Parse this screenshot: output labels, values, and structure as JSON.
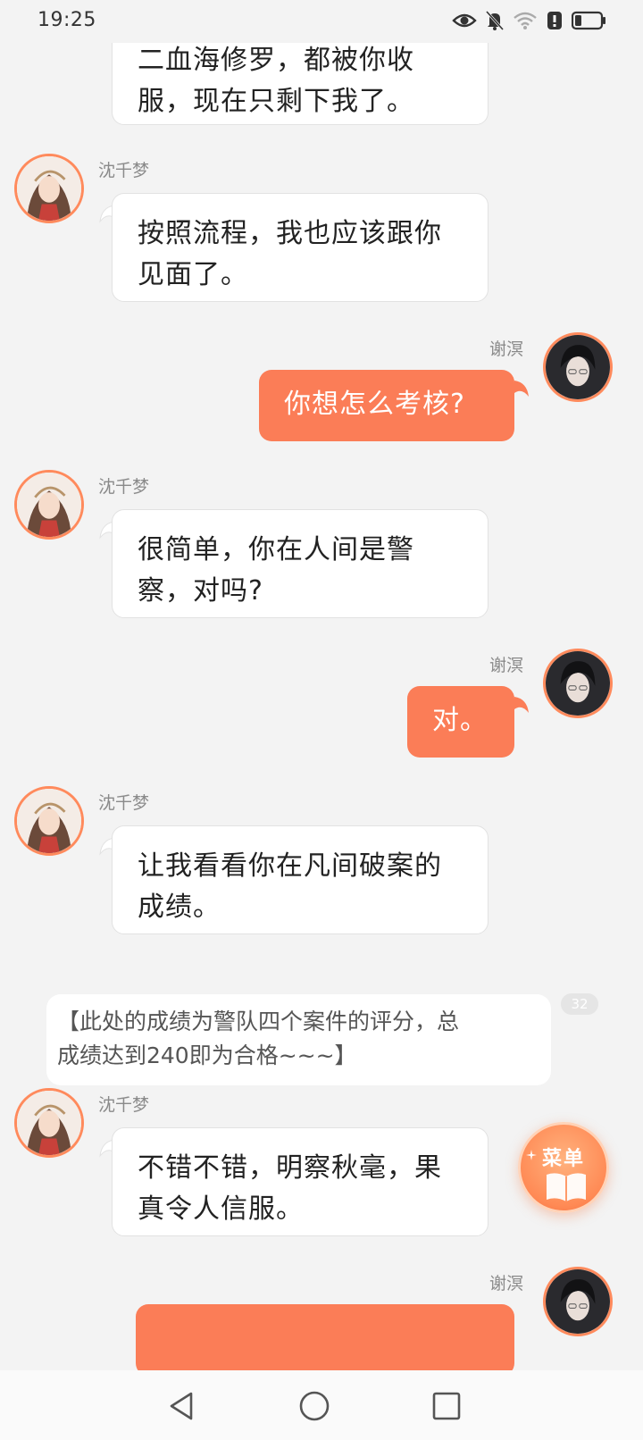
{
  "status_bar": {
    "time": "19:25",
    "icons": [
      "eye-icon",
      "bell-muted-icon",
      "wifi-icon",
      "alert-icon",
      "battery-icon"
    ]
  },
  "messages": [
    {
      "sender": "",
      "side": "left",
      "text_lines": [
        "二血海修罗，都被你收",
        "服，现在只剩下我了。"
      ]
    },
    {
      "sender": "沈千梦",
      "side": "left",
      "text_lines": [
        "按照流程，我也应该跟你",
        "见面了。"
      ]
    },
    {
      "sender": "谢溟",
      "side": "right",
      "text_lines": [
        "你想怎么考核?"
      ]
    },
    {
      "sender": "沈千梦",
      "side": "left",
      "text_lines": [
        "很简单，你在人间是警",
        "察，对吗?"
      ]
    },
    {
      "sender": "谢溟",
      "side": "right",
      "text_lines": [
        "对。"
      ]
    },
    {
      "sender": "沈千梦",
      "side": "left",
      "text_lines": [
        "让我看看你在凡间破案的",
        "成绩。"
      ]
    },
    {
      "sender": "沈千梦",
      "side": "left",
      "text_lines": [
        "不错不错，明察秋毫，果",
        "真令人信服。"
      ]
    },
    {
      "sender": "谢溟",
      "side": "right",
      "text_lines": [
        ""
      ]
    }
  ],
  "narration": {
    "lines": [
      "【此处的成绩为警队四个案件的评分，总",
      "成绩达到240即为合格~~~】"
    ],
    "count": "32"
  },
  "menu_button": {
    "label": "菜单",
    "icon": "book-icon"
  },
  "nav_bar": {
    "buttons": [
      "back-icon",
      "home-icon",
      "recents-icon"
    ]
  },
  "colors": {
    "background": "#f3f3f3",
    "self_bubble": "#fb7d57",
    "avatar_ring": "#ff8a5c"
  }
}
